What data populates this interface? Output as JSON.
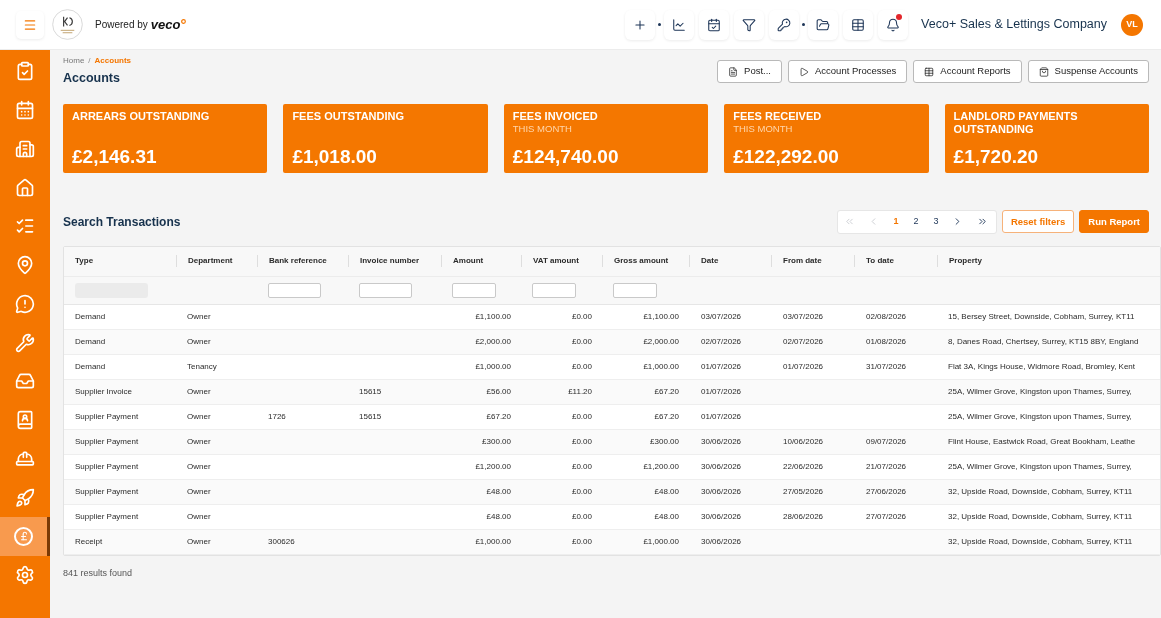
{
  "top_bar": {
    "powered_by": "Powered by",
    "brand": "veco",
    "notifications_unread": true,
    "company": "Veco+ Sales & Lettings Company",
    "avatar": "VL"
  },
  "sidebar": {
    "items": [
      {
        "selected": false
      },
      {
        "selected": false
      },
      {
        "selected": false
      },
      {
        "selected": false
      },
      {
        "selected": false
      },
      {
        "selected": false
      },
      {
        "selected": false
      },
      {
        "selected": false
      },
      {
        "selected": false
      },
      {
        "selected": false
      },
      {
        "selected": false
      },
      {
        "selected": false
      },
      {
        "selected": true
      },
      {
        "selected": false
      }
    ]
  },
  "breadcrumb": {
    "separator": "/",
    "items": [
      {
        "label": "Home",
        "current": false
      },
      {
        "label": "Accounts",
        "current": true
      }
    ]
  },
  "title": "Accounts",
  "actions": [
    {
      "label": "Post..."
    },
    {
      "label": "Account Processes"
    },
    {
      "label": "Account Reports"
    },
    {
      "label": "Suspense Accounts"
    }
  ],
  "stat_cards": [
    {
      "title": "ARREARS OUTSTANDING",
      "value": "£2,146.31"
    },
    {
      "title": "FEES OUTSTANDING",
      "value": "£1,018.00"
    },
    {
      "title": "FEES INVOICED",
      "subtitle": "THIS MONTH",
      "value": "£124,740.00"
    },
    {
      "title": "FEES RECEIVED",
      "subtitle": "THIS MONTH",
      "value": "£122,292.00"
    },
    {
      "title": "LANDLORD PAYMENTS OUTSTANDING",
      "value": "£1,720.20"
    }
  ],
  "search": {
    "title": "Search Transactions",
    "pagination": {
      "first_disabled": true,
      "prev_disabled": true,
      "pages": [
        {
          "label": "1",
          "selected": true
        },
        {
          "label": "2",
          "selected": false
        },
        {
          "label": "3",
          "selected": false
        }
      ],
      "next_disabled": false,
      "last_disabled": false
    },
    "buttons": [
      {
        "label": "Reset filters",
        "kind": "outline"
      },
      {
        "label": "Run Report",
        "kind": "primary"
      }
    ]
  },
  "table": {
    "columns": [
      {
        "label": "Type",
        "kind": "text",
        "filter": {
          "kind": "input",
          "disabled": true
        }
      },
      {
        "label": "Department",
        "kind": "text"
      },
      {
        "label": "Bank reference",
        "kind": "text",
        "filter": {
          "kind": "input",
          "disabled": false
        }
      },
      {
        "label": "Invoice number",
        "kind": "text",
        "filter": {
          "kind": "input",
          "disabled": false
        }
      },
      {
        "label": "Amount",
        "kind": "money",
        "filter": {
          "kind": "input",
          "disabled": false
        }
      },
      {
        "label": "VAT amount",
        "kind": "money",
        "filter": {
          "kind": "input",
          "disabled": false
        }
      },
      {
        "label": "Gross amount",
        "kind": "money",
        "filter": {
          "kind": "input",
          "disabled": false
        }
      },
      {
        "label": "Date",
        "kind": "date"
      },
      {
        "label": "From date",
        "kind": "date"
      },
      {
        "label": "To date",
        "kind": "date"
      },
      {
        "label": "Property",
        "kind": "text"
      }
    ],
    "rows": [
      {
        "type": "Demand",
        "department": "Owner",
        "amount": "£1,100.00",
        "vat_amount": "£0.00",
        "gross_amount": "£1,100.00",
        "date": "03/07/2026",
        "from_date": "03/07/2026",
        "to_date": "02/08/2026",
        "property": "15, Bersey Street, Downside, Cobham, Surrey, KT11"
      },
      {
        "type": "Demand",
        "department": "Owner",
        "amount": "£2,000.00",
        "vat_amount": "£0.00",
        "gross_amount": "£2,000.00",
        "date": "02/07/2026",
        "from_date": "02/07/2026",
        "to_date": "01/08/2026",
        "property": "8, Danes Road, Chertsey, Surrey, KT15 8BY, England"
      },
      {
        "type": "Demand",
        "department": "Tenancy",
        "amount": "£1,000.00",
        "vat_amount": "£0.00",
        "gross_amount": "£1,000.00",
        "date": "01/07/2026",
        "from_date": "01/07/2026",
        "to_date": "31/07/2026",
        "property": "Flat 3A, Kings House, Widmore Road, Bromley, Kent"
      },
      {
        "type": "Supplier Invoice",
        "department": "Owner",
        "invoice_number": "15615",
        "amount": "£56.00",
        "vat_amount": "£11.20",
        "gross_amount": "£67.20",
        "date": "01/07/2026",
        "property": "25A, Wilmer Grove, Kingston upon Thames, Surrey,"
      },
      {
        "type": "Supplier Payment",
        "department": "Owner",
        "bank_reference": "1726",
        "invoice_number": "15615",
        "amount": "£67.20",
        "vat_amount": "£0.00",
        "gross_amount": "£67.20",
        "date": "01/07/2026",
        "property": "25A, Wilmer Grove, Kingston upon Thames, Surrey,"
      },
      {
        "type": "Supplier Payment",
        "department": "Owner",
        "amount": "£300.00",
        "vat_amount": "£0.00",
        "gross_amount": "£300.00",
        "date": "30/06/2026",
        "from_date": "10/06/2026",
        "to_date": "09/07/2026",
        "property": "Flint House, Eastwick Road, Great Bookham, Leathe"
      },
      {
        "type": "Supplier Payment",
        "department": "Owner",
        "amount": "£1,200.00",
        "vat_amount": "£0.00",
        "gross_amount": "£1,200.00",
        "date": "30/06/2026",
        "from_date": "22/06/2026",
        "to_date": "21/07/2026",
        "property": "25A, Wilmer Grove, Kingston upon Thames, Surrey,"
      },
      {
        "type": "Supplier Payment",
        "department": "Owner",
        "amount": "£48.00",
        "vat_amount": "£0.00",
        "gross_amount": "£48.00",
        "date": "30/06/2026",
        "from_date": "27/05/2026",
        "to_date": "27/06/2026",
        "property": "32, Upside Road, Downside, Cobham, Surrey, KT11"
      },
      {
        "type": "Supplier Payment",
        "department": "Owner",
        "amount": "£48.00",
        "vat_amount": "£0.00",
        "gross_amount": "£48.00",
        "date": "30/06/2026",
        "from_date": "28/06/2026",
        "to_date": "27/07/2026",
        "property": "32, Upside Road, Downside, Cobham, Surrey, KT11"
      },
      {
        "type": "Receipt",
        "department": "Owner",
        "bank_reference": "300626",
        "amount": "£1,000.00",
        "vat_amount": "£0.00",
        "gross_amount": "£1,000.00",
        "date": "30/06/2026",
        "property": "32, Upside Road, Downside, Cobham, Surrey, KT11"
      }
    ]
  },
  "results": "841 results found"
}
